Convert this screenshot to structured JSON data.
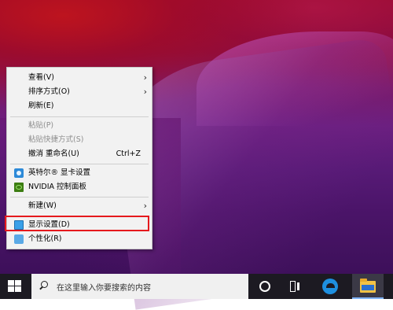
{
  "context_menu": {
    "items": [
      {
        "label": "查看(V)",
        "has_submenu": true
      },
      {
        "label": "排序方式(O)",
        "has_submenu": true
      },
      {
        "label": "刷新(E)"
      },
      {
        "label": "粘贴(P)",
        "disabled": true
      },
      {
        "label": "粘贴快捷方式(S)",
        "disabled": true
      },
      {
        "label": "撤消 重命名(U)",
        "shortcut": "Ctrl+Z"
      },
      {
        "label": "英特尔® 显卡设置",
        "icon": "intel-graphics-icon"
      },
      {
        "label": "NVIDIA 控制面板",
        "icon": "nvidia-icon"
      },
      {
        "label": "新建(W)",
        "has_submenu": true
      },
      {
        "label": "显示设置(D)",
        "icon": "display-settings-icon",
        "highlighted": true
      },
      {
        "label": "个性化(R)",
        "icon": "personalize-icon"
      }
    ]
  },
  "taskbar": {
    "search_placeholder": "在这里输入你要搜索的内容",
    "icons": [
      "windows-start-icon",
      "search-icon",
      "cortana-icon",
      "task-view-icon",
      "edge-icon",
      "file-explorer-icon"
    ]
  },
  "colors": {
    "highlight_border": "#e5191d",
    "taskbar": "#1c1a22"
  }
}
